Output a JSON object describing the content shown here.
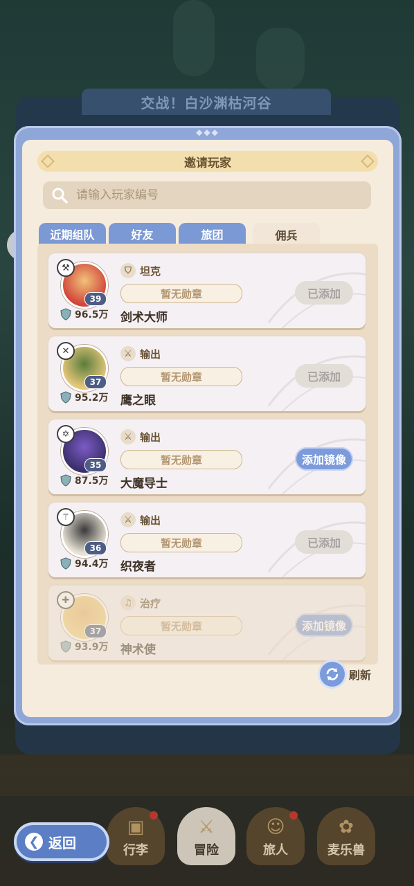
{
  "background_header": "交战！白沙渊枯河谷",
  "dialog": {
    "title": "邀请玩家",
    "search_placeholder": "请输入玩家编号",
    "tabs": [
      {
        "label": "近期组队",
        "active": false
      },
      {
        "label": "好友",
        "active": false
      },
      {
        "label": "旅团",
        "active": false
      },
      {
        "label": "佣兵",
        "active": true
      }
    ],
    "players": [
      {
        "level": "39",
        "power": "96.5万",
        "role": "坦克",
        "medal": "暂无勋章",
        "name": "剑术大师",
        "action": "已添加",
        "action_type": "added",
        "avatar_colors": [
          "#d2453a",
          "#f0c27a"
        ],
        "class_icon": "⚒",
        "role_icon": "⛉",
        "dimmed": false
      },
      {
        "level": "37",
        "power": "95.2万",
        "role": "输出",
        "medal": "暂无勋章",
        "name": "鹰之眼",
        "action": "已添加",
        "action_type": "added",
        "avatar_colors": [
          "#e6c77a",
          "#5a7d3c"
        ],
        "class_icon": "✕",
        "role_icon": "⚔",
        "dimmed": false
      },
      {
        "level": "35",
        "power": "87.5万",
        "role": "输出",
        "medal": "暂无勋章",
        "name": "大魔导士",
        "action": "添加镜像",
        "action_type": "mirror",
        "avatar_colors": [
          "#3b2f6b",
          "#7b5bc4"
        ],
        "class_icon": "✡",
        "role_icon": "⚔",
        "dimmed": false
      },
      {
        "level": "36",
        "power": "94.4万",
        "role": "输出",
        "medal": "暂无勋章",
        "name": "织夜者",
        "action": "已添加",
        "action_type": "added",
        "avatar_colors": [
          "#e9e3d6",
          "#3a3a3a"
        ],
        "class_icon": "⚚",
        "role_icon": "⚔",
        "dimmed": false
      },
      {
        "level": "37",
        "power": "93.9万",
        "role": "治疗",
        "medal": "暂无勋章",
        "name": "神术使",
        "action": "添加镜像",
        "action_type": "mirror",
        "avatar_colors": [
          "#f3d27a",
          "#e8b36b"
        ],
        "class_icon": "✚",
        "role_icon": "♫",
        "dimmed": true
      }
    ],
    "refresh_label": "刷新"
  },
  "bottom_nav": {
    "back_label": "返回",
    "items": [
      {
        "label": "行李",
        "icon": "bag-icon",
        "badge": true
      },
      {
        "label": "冒险",
        "icon": "crossed-swords-icon",
        "badge": false
      },
      {
        "label": "旅人",
        "icon": "traveler-icon",
        "badge": true
      },
      {
        "label": "麦乐兽",
        "icon": "pet-icon",
        "badge": false
      }
    ]
  }
}
